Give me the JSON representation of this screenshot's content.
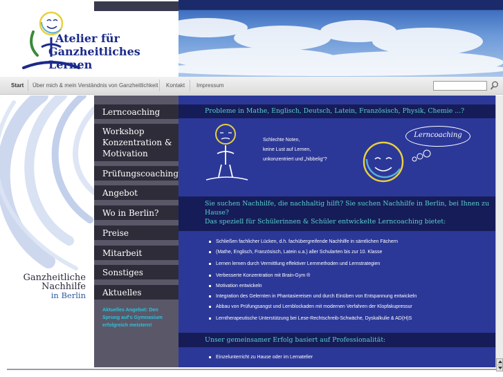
{
  "header": {
    "logo_line1": "Atelier für",
    "logo_line2": "Ganzheitliches Lernen"
  },
  "nav": {
    "items": [
      {
        "label": "Start",
        "active": true
      },
      {
        "label": "Über mich & mein Verständnis von Ganzheitlichkeit",
        "active": false
      },
      {
        "label": "Kontakt",
        "active": false
      },
      {
        "label": "Impressum",
        "active": false
      }
    ],
    "search_value": "",
    "search_icon": "magnifier-icon"
  },
  "side_title": {
    "line1": "Ganzheitliche",
    "line2": "Nachhilfe",
    "line3": "in Berlin"
  },
  "menu": {
    "items": [
      "Lerncoaching",
      "Workshop Konzentration & Motivation",
      "Prüfungscoaching",
      "Angebot",
      "Wo in Berlin?",
      "Preise",
      "Mitarbeit",
      "Sonstiges",
      "Aktuelles"
    ],
    "promo": "Aktuelles Angebot: Den Sprung auf's Gymnasium erfolgreich meistern!"
  },
  "content": {
    "heading": "Probleme in Mathe, Englisch, Deutsch, Latein, Französisch, Physik, Chemie ...?",
    "speech_line1": "Schlechte Noten,",
    "speech_line2": "keine Lust auf Lernen,",
    "speech_line3": "unkonzentriert und „hibbelig“?",
    "bubble": "Lerncoaching",
    "highlight_line1": "Sie suchen Nachhilfe, die nachhaltig hilft? Sie suchen Nachhilfe in Berlin, bei Ihnen zu",
    "highlight_line2": "Hause?",
    "highlight_line3": "Das speziell für Schülerinnen & Schüler entwickelte Lerncoaching bietet:",
    "bullets": [
      "Schließen fachlicher Lücken, d.h. fachübergreifende Nachhilfe in sämtlichen Fächern",
      "(Mathe, Englisch, Französisch, Latein u.a.) aller Schularten bis zur 10. Klasse",
      "Lernen lernen durch Vermittlung effektiver Lernmethoden und Lernstrategien",
      "Verbesserte Konzentration mit Brain-Gym ®",
      "Motivation entwickeln",
      "Integration des Gelernten in Phantasiereisen und durch Einüben von Entspannung entwickeln",
      "Abbau von Prüfungsangst und Lernblockaden mit modernen Verfahren der Klopfakupressur",
      "Lerntherapeutische Unterstützung bei Lese-Rechtschreib-Schwäche, Dyskalkulie & AD(H)S"
    ],
    "success_heading": "Unser gemeinsamer Erfolg basiert auf Professionalität:",
    "bullets2": [
      "Einzelunterricht zu Hause oder im Lernatelier"
    ]
  },
  "colors": {
    "content_bg": "#2c3898",
    "band_bg": "#161c58",
    "accent_teal": "#5ad0d0",
    "menu_item_bg": "#2e2c38",
    "logo_blue": "#1a2a8a"
  }
}
